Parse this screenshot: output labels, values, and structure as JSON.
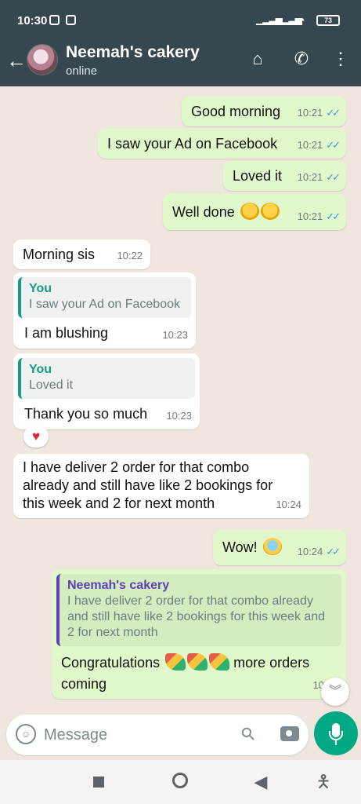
{
  "status_bar": {
    "time": "10:30",
    "battery": "73",
    "colors": {
      "bar": "#37474f"
    }
  },
  "header": {
    "contact_name": "Neemah's cakery",
    "contact_status": "online",
    "icons": [
      "back-arrow-icon",
      "store-icon",
      "add-call-icon",
      "more-vert-icon"
    ]
  },
  "messages": [
    {
      "text": "Good morning",
      "time": "10:21",
      "direction": "out"
    },
    {
      "text": "I saw your Ad on Facebook",
      "time": "10:21",
      "direction": "out"
    },
    {
      "text": "Loved it",
      "time": "10:21",
      "direction": "out"
    },
    {
      "text": "Well done",
      "time": "10:21",
      "direction": "out",
      "emoji": [
        "clapping-hands",
        "clapping-hands"
      ]
    },
    {
      "text": "Morning sis",
      "time": "10:22",
      "direction": "in"
    },
    {
      "quote_name": "You",
      "quote_text": "I saw your Ad on Facebook",
      "text": "I am blushing",
      "time": "10:23",
      "direction": "in"
    },
    {
      "quote_name": "You",
      "quote_text": "Loved it",
      "text": "Thank you so much",
      "time": "10:23",
      "direction": "in",
      "reaction": "heart"
    },
    {
      "text": "I have deliver 2 order for that combo already and still have like 2 bookings for this week and 2 for next month",
      "time": "10:24",
      "direction": "in"
    },
    {
      "text": "Wow!",
      "time": "10:24",
      "direction": "out",
      "emoji": [
        "screaming-face"
      ]
    },
    {
      "quote_name": "Neemah's cakery",
      "quote_text": "I have deliver 2 order for that combo already and still have like 2 bookings for this week and 2 for next month",
      "text_before": "Congratulations",
      "text_after": "more orders coming",
      "time": "10:25",
      "direction": "out",
      "emoji": [
        "party-popper",
        "party-popper",
        "party-popper"
      ]
    }
  ],
  "composer": {
    "placeholder": "Message"
  },
  "colors": {
    "outgoing_bubble": "#e1f8cb",
    "incoming_bubble": "#ffffff",
    "read_ticks": "#2f9fe6",
    "mic_button": "#00a884",
    "chat_background": "#efe7de"
  }
}
